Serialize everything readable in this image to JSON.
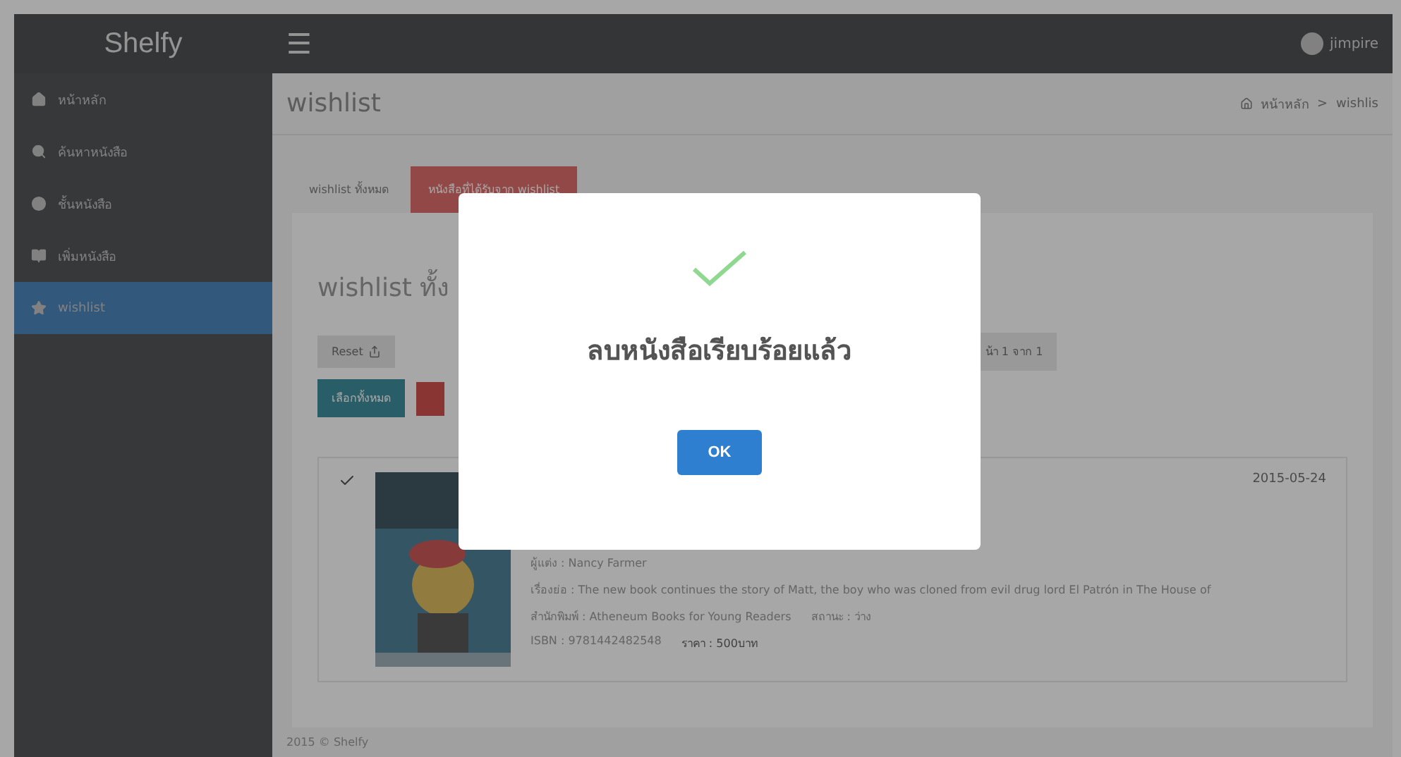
{
  "brand": "Shelfy",
  "menu_icon": "☰",
  "user": {
    "name": "jimpire"
  },
  "sidebar": {
    "items": [
      {
        "label": "หน้าหลัก",
        "selected": false
      },
      {
        "label": "ค้นหาหนังสือ",
        "selected": false
      },
      {
        "label": "ชั้นหนังสือ",
        "selected": false
      },
      {
        "label": "เพิ่มหนังสือ",
        "selected": false
      },
      {
        "label": "wishlist",
        "selected": true
      }
    ]
  },
  "page_title": "wishlist",
  "breadcrumb": [
    "หน้าหลัก",
    "wishlis"
  ],
  "breadcrumb_separator": ">",
  "tabs": [
    {
      "label": "wishlist ทั้งหมด",
      "selected": false
    },
    {
      "label": "หนังสือที่ได้รับจาก wishlist",
      "selected": true
    }
  ],
  "panel_title": "wishlist ทั้ง",
  "toolbar": {
    "reset": "Reset",
    "select_all": "เลือกทั้งหมด",
    "pager": "น้า 1 จาก 1"
  },
  "book": {
    "checked": true,
    "date": "2015-05-24",
    "author": "ผู้แต่ง : Nancy Farmer",
    "description": "เรื่องย่อ : The new book continues the story of Matt, the boy who was cloned from evil drug lord El Patrón in The House of",
    "publisher": "สำนักพิมพ์ : Atheneum Books for Young Readers",
    "status": "สถานะ : ว่าง",
    "isbn": "ISBN : 9781442482548",
    "price": "ราคา : 500บาท"
  },
  "footer": "2015 © Shelfy",
  "dialog": {
    "message": "ลบหนังสือเรียบร้อยแล้ว",
    "button": "OK"
  }
}
